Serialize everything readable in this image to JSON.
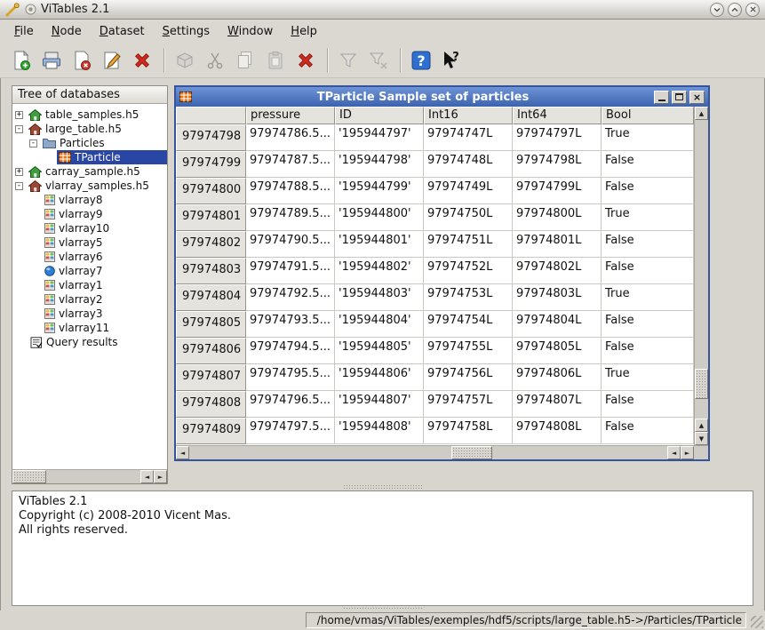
{
  "app": {
    "title": "ViTables 2.1"
  },
  "window_controls": {
    "buttons": [
      "minimize",
      "maximize",
      "close"
    ]
  },
  "menubar": {
    "items": [
      {
        "accel": "F",
        "rest": "ile"
      },
      {
        "accel": "N",
        "rest": "ode"
      },
      {
        "accel": "D",
        "rest": "ataset"
      },
      {
        "accel": "S",
        "rest": "ettings"
      },
      {
        "accel": "W",
        "rest": "indow"
      },
      {
        "accel": "H",
        "rest": "elp"
      }
    ]
  },
  "toolbar": {
    "buttons": [
      "new-file-icon",
      "open-file-icon",
      "close-file-icon",
      "save-as-icon",
      "quit-icon",
      "node-package-icon",
      "cut-node-icon",
      "copy-node-icon",
      "paste-node-icon",
      "delete-node-icon",
      "filter-icon",
      "filter-edit-icon",
      "help-icon",
      "whats-this-icon"
    ]
  },
  "tree": {
    "header": "Tree of databases",
    "items": [
      {
        "label": "table_samples.h5",
        "level": 0,
        "expander": "+",
        "icon": "home-green-icon",
        "selected": false
      },
      {
        "label": "large_table.h5",
        "level": 0,
        "expander": "-",
        "icon": "home-maroon-icon",
        "selected": false
      },
      {
        "label": "Particles",
        "level": 1,
        "expander": "-",
        "icon": "folder-icon",
        "selected": false
      },
      {
        "label": "TParticle",
        "level": 2,
        "expander": "",
        "icon": "table-icon",
        "selected": true
      },
      {
        "label": "carray_sample.h5",
        "level": 0,
        "expander": "+",
        "icon": "home-green-icon",
        "selected": false
      },
      {
        "label": "vlarray_samples.h5",
        "level": 0,
        "expander": "-",
        "icon": "home-maroon-icon",
        "selected": false
      },
      {
        "label": "vlarray8",
        "level": 1,
        "expander": "",
        "icon": "vlarray-icon",
        "selected": false
      },
      {
        "label": "vlarray9",
        "level": 1,
        "expander": "",
        "icon": "vlarray-icon",
        "selected": false
      },
      {
        "label": "vlarray10",
        "level": 1,
        "expander": "",
        "icon": "vlarray-icon",
        "selected": false
      },
      {
        "label": "vlarray5",
        "level": 1,
        "expander": "",
        "icon": "vlarray-icon",
        "selected": false
      },
      {
        "label": "vlarray6",
        "level": 1,
        "expander": "",
        "icon": "vlarray-icon",
        "selected": false
      },
      {
        "label": "vlarray7",
        "level": 1,
        "expander": "",
        "icon": "sphere-icon",
        "selected": false
      },
      {
        "label": "vlarray1",
        "level": 1,
        "expander": "",
        "icon": "vlarray-icon",
        "selected": false
      },
      {
        "label": "vlarray2",
        "level": 1,
        "expander": "",
        "icon": "vlarray-icon",
        "selected": false
      },
      {
        "label": "vlarray3",
        "level": 1,
        "expander": "",
        "icon": "vlarray-icon",
        "selected": false
      },
      {
        "label": "vlarray11",
        "level": 1,
        "expander": "",
        "icon": "vlarray-icon",
        "selected": false
      },
      {
        "label": "Query results",
        "level": 0,
        "expander": "",
        "icon": "query-results-icon",
        "selected": false
      }
    ]
  },
  "child": {
    "title": "TParticle Sample set of particles",
    "controls": [
      "minimize",
      "maximize",
      "close"
    ],
    "columns": [
      "pressure",
      "ID",
      "Int16",
      "Int64",
      "Bool"
    ],
    "rows": [
      {
        "h": "97974798",
        "c": [
          "97974786.5...",
          "'195944797'",
          "97974747L",
          "97974797L",
          "True"
        ]
      },
      {
        "h": "97974799",
        "c": [
          "97974787.5...",
          "'195944798'",
          "97974748L",
          "97974798L",
          "False"
        ]
      },
      {
        "h": "97974800",
        "c": [
          "97974788.5...",
          "'195944799'",
          "97974749L",
          "97974799L",
          "False"
        ]
      },
      {
        "h": "97974801",
        "c": [
          "97974789.5...",
          "'195944800'",
          "97974750L",
          "97974800L",
          "True"
        ]
      },
      {
        "h": "97974802",
        "c": [
          "97974790.5...",
          "'195944801'",
          "97974751L",
          "97974801L",
          "False"
        ]
      },
      {
        "h": "97974803",
        "c": [
          "97974791.5...",
          "'195944802'",
          "97974752L",
          "97974802L",
          "False"
        ]
      },
      {
        "h": "97974804",
        "c": [
          "97974792.5...",
          "'195944803'",
          "97974753L",
          "97974803L",
          "True"
        ]
      },
      {
        "h": "97974805",
        "c": [
          "97974793.5...",
          "'195944804'",
          "97974754L",
          "97974804L",
          "False"
        ]
      },
      {
        "h": "97974806",
        "c": [
          "97974794.5...",
          "'195944805'",
          "97974755L",
          "97974805L",
          "False"
        ]
      },
      {
        "h": "97974807",
        "c": [
          "97974795.5...",
          "'195944806'",
          "97974756L",
          "97974806L",
          "True"
        ]
      },
      {
        "h": "97974808",
        "c": [
          "97974796.5...",
          "'195944807'",
          "97974757L",
          "97974807L",
          "False"
        ]
      },
      {
        "h": "97974809",
        "c": [
          "97974797.5...",
          "'195944808'",
          "97974758L",
          "97974808L",
          "False"
        ]
      }
    ]
  },
  "log": {
    "lines": [
      "ViTables 2.1",
      "Copyright (c) 2008-2010 Vicent Mas.",
      "All rights reserved."
    ]
  },
  "statusbar": {
    "path": "/home/vmas/ViTables/exemples/hdf5/scripts/large_table.h5->/Particles/TParticle"
  },
  "colors": {
    "selection": "#2a46a5",
    "child_titlebar": "#3c63b0",
    "table_icon": "#e2771f",
    "help_blue": "#2f6fd0"
  }
}
